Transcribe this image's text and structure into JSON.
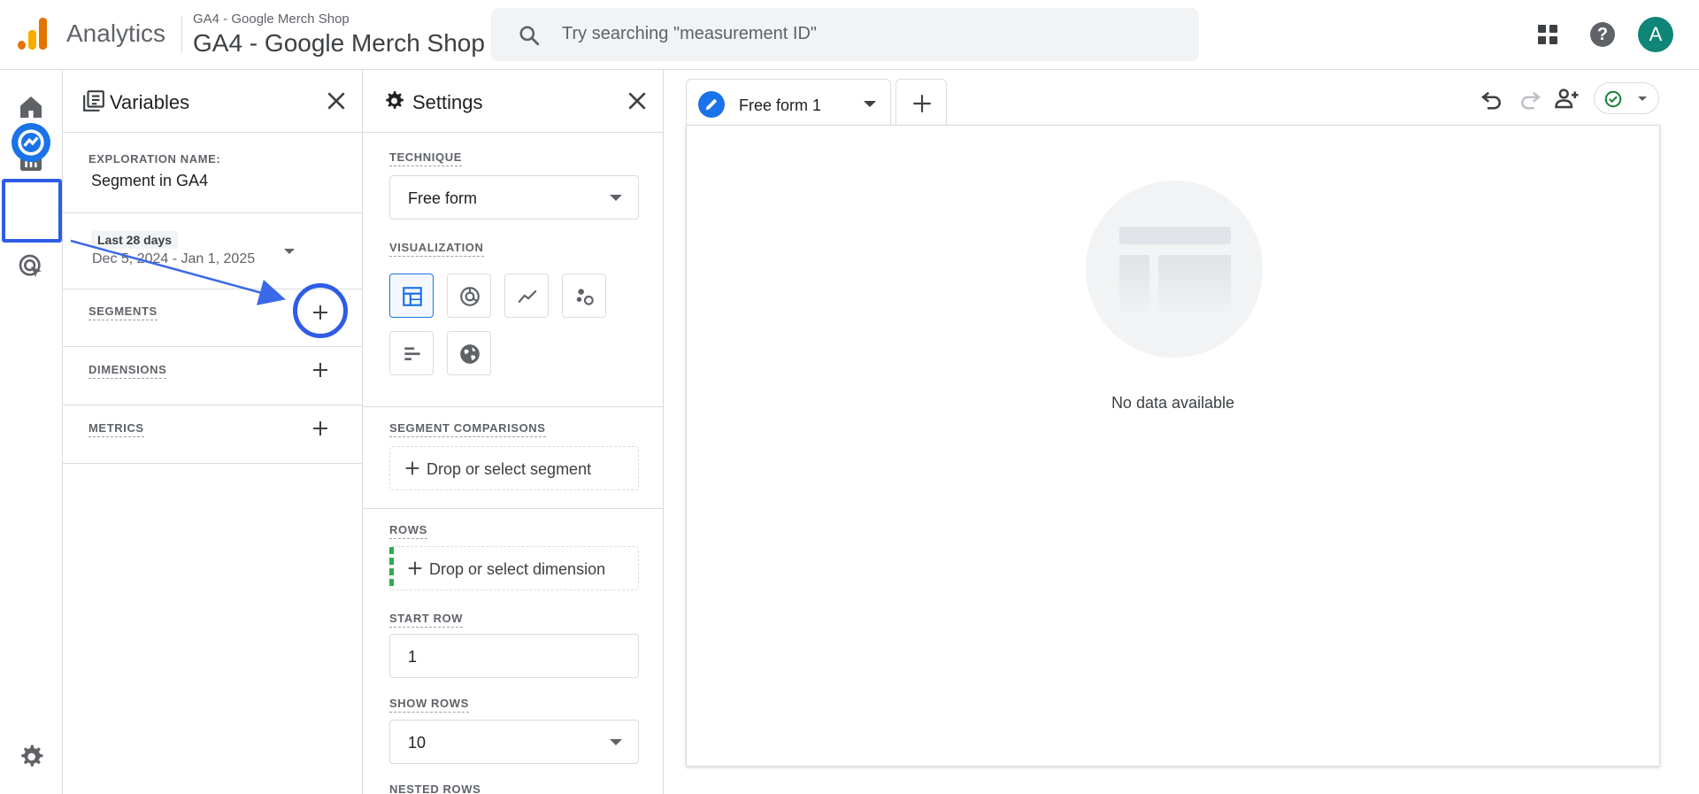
{
  "topbar": {
    "app_name": "Analytics",
    "property_small": "GA4 - Google Merch Shop",
    "property_large": "GA4 - Google Merch Shop",
    "search_placeholder": "Try searching \"measurement ID\"",
    "avatar_initial": "A",
    "help_glyph": "?"
  },
  "leftnav": {
    "items": [
      "home-icon",
      "reports-icon",
      "explore-icon",
      "advertising-icon"
    ],
    "settings": "gear-icon"
  },
  "variables": {
    "title": "Variables",
    "exploration_name_label": "EXPLORATION NAME:",
    "exploration_name": "Segment in GA4",
    "date_badge": "Last 28 days",
    "date_range": "Dec 5, 2024 - Jan 1, 2025",
    "segments_label": "SEGMENTS",
    "dimensions_label": "DIMENSIONS",
    "metrics_label": "METRICS"
  },
  "settings": {
    "title": "Settings",
    "technique_label": "TECHNIQUE",
    "technique_value": "Free form",
    "visualization_label": "VISUALIZATION",
    "visualizations": [
      "table-icon",
      "donut-chart-icon",
      "line-chart-icon",
      "scatter-chart-icon",
      "bar-chart-icon",
      "geo-map-icon"
    ],
    "segment_comparisons_label": "SEGMENT COMPARISONS",
    "segment_drop_text": "Drop or select segment",
    "rows_label": "ROWS",
    "rows_drop_text": "Drop or select dimension",
    "start_row_label": "START ROW",
    "start_row_value": "1",
    "show_rows_label": "SHOW ROWS",
    "show_rows_value": "10",
    "nested_rows_label": "NESTED ROWS"
  },
  "canvas": {
    "tab_label": "Free form 1",
    "empty_message": "No data available"
  },
  "colors": {
    "accent": "#1a73e8",
    "highlight": "#2e5ce6",
    "avatar": "#0f8577",
    "logo_orange": "#f9ab00",
    "logo_dark_orange": "#e37400"
  }
}
